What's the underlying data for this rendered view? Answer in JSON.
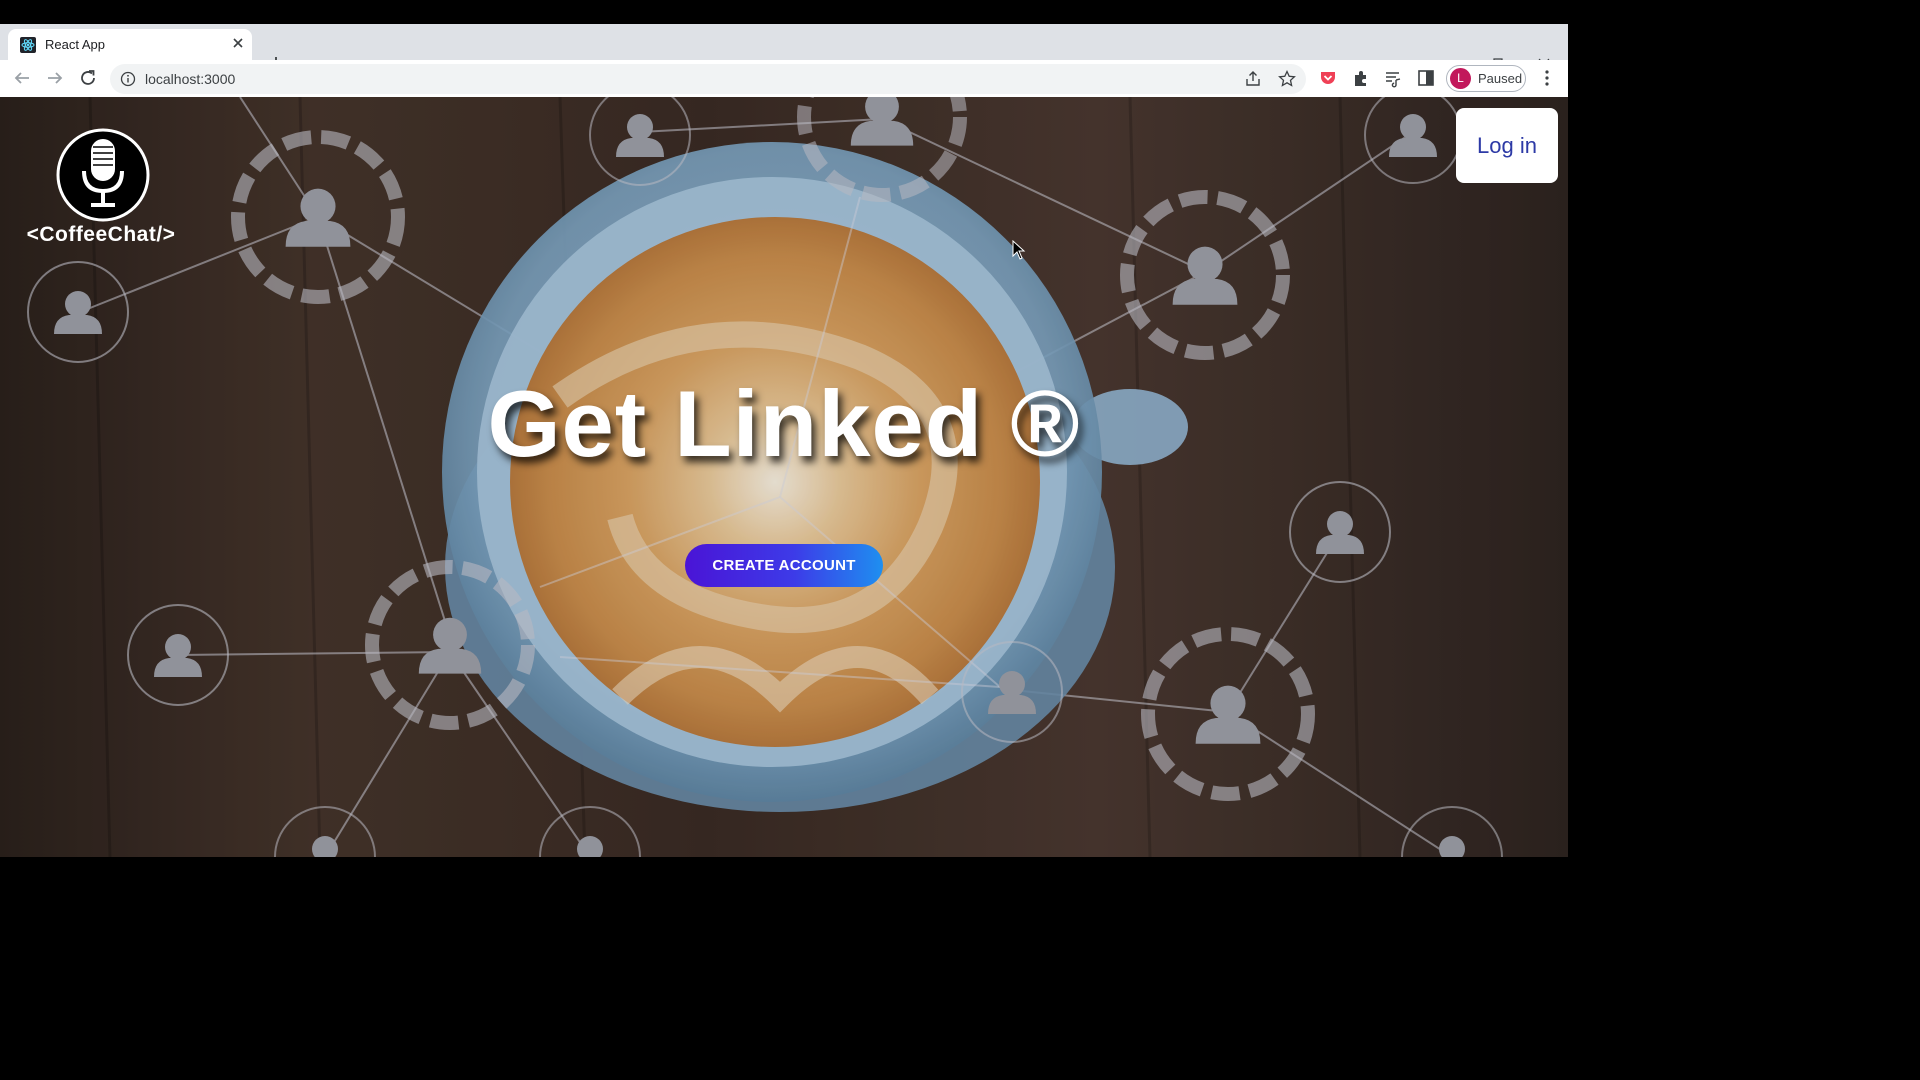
{
  "browser": {
    "tab_title": "React App",
    "url": "localhost:3000",
    "profile_initial": "L",
    "profile_status": "Paused"
  },
  "page": {
    "logo_text": "<CoffeeChat/>",
    "login_label": "Log in",
    "hero_title": "Get Linked ®",
    "cta_label": "CREATE ACCOUNT"
  },
  "colors": {
    "cta_gradient_start": "#4a14d6",
    "cta_gradient_end": "#1e8ff0",
    "login_text": "#2d3aa6",
    "profile_avatar": "#c2185b"
  }
}
